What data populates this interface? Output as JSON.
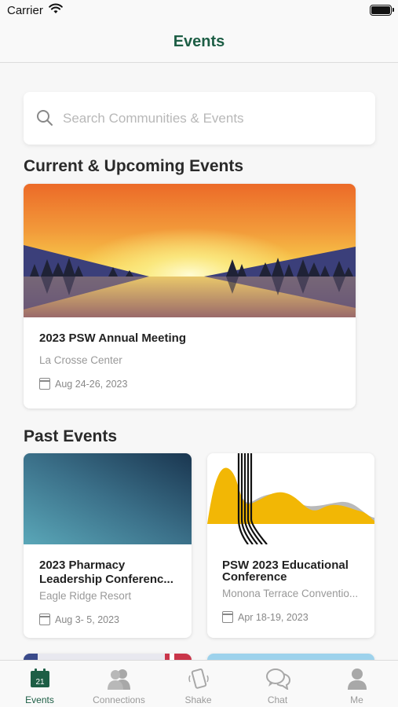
{
  "status_bar": {
    "carrier": "Carrier"
  },
  "nav": {
    "title": "Events"
  },
  "search": {
    "placeholder": "Search Communities & Events"
  },
  "sections": {
    "current": "Current & Upcoming Events",
    "past": "Past Events"
  },
  "current_events": [
    {
      "title": "2023 PSW Annual Meeting",
      "location": "La Crosse Center",
      "date": "Aug 24-26, 2023"
    }
  ],
  "past_events": [
    {
      "title_line1": "2023 Pharmacy",
      "title_line2": "Leadership Conferenc...",
      "location": "Eagle Ridge Resort",
      "date": "Aug  3- 5, 2023"
    },
    {
      "title_line1": "PSW 2023 Educational",
      "title_line2": "Conference",
      "location": "Monona Terrace Conventio...",
      "date": "Apr 18-19, 2023"
    }
  ],
  "tabs": [
    {
      "label": "Events",
      "icon": "calendar-icon",
      "badge": "21",
      "active": true
    },
    {
      "label": "Connections",
      "icon": "people-icon",
      "active": false
    },
    {
      "label": "Shake",
      "icon": "phone-shake-icon",
      "active": false
    },
    {
      "label": "Chat",
      "icon": "chat-bubbles-icon",
      "active": false
    },
    {
      "label": "Me",
      "icon": "person-icon",
      "active": false
    }
  ],
  "colors": {
    "brand": "#1d5e45",
    "inactive": "#9a9a9a"
  }
}
